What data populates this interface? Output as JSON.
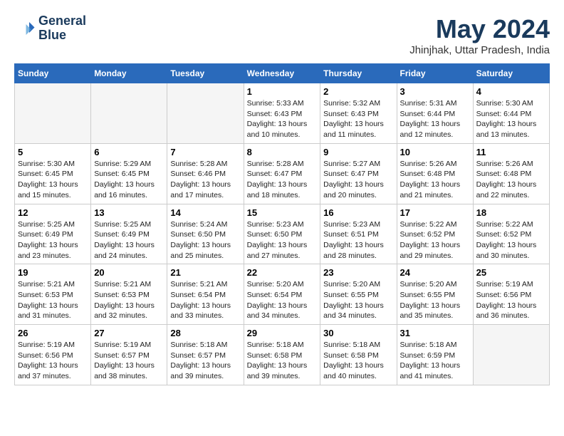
{
  "header": {
    "logo_line1": "General",
    "logo_line2": "Blue",
    "month": "May 2024",
    "location": "Jhinjhak, Uttar Pradesh, India"
  },
  "weekdays": [
    "Sunday",
    "Monday",
    "Tuesday",
    "Wednesday",
    "Thursday",
    "Friday",
    "Saturday"
  ],
  "weeks": [
    [
      {
        "day": "",
        "empty": true
      },
      {
        "day": "",
        "empty": true
      },
      {
        "day": "",
        "empty": true
      },
      {
        "day": "1",
        "sunrise": "5:33 AM",
        "sunset": "6:43 PM",
        "daylight": "13 hours and 10 minutes."
      },
      {
        "day": "2",
        "sunrise": "5:32 AM",
        "sunset": "6:43 PM",
        "daylight": "13 hours and 11 minutes."
      },
      {
        "day": "3",
        "sunrise": "5:31 AM",
        "sunset": "6:44 PM",
        "daylight": "13 hours and 12 minutes."
      },
      {
        "day": "4",
        "sunrise": "5:30 AM",
        "sunset": "6:44 PM",
        "daylight": "13 hours and 13 minutes."
      }
    ],
    [
      {
        "day": "5",
        "sunrise": "5:30 AM",
        "sunset": "6:45 PM",
        "daylight": "13 hours and 15 minutes."
      },
      {
        "day": "6",
        "sunrise": "5:29 AM",
        "sunset": "6:45 PM",
        "daylight": "13 hours and 16 minutes."
      },
      {
        "day": "7",
        "sunrise": "5:28 AM",
        "sunset": "6:46 PM",
        "daylight": "13 hours and 17 minutes."
      },
      {
        "day": "8",
        "sunrise": "5:28 AM",
        "sunset": "6:47 PM",
        "daylight": "13 hours and 18 minutes."
      },
      {
        "day": "9",
        "sunrise": "5:27 AM",
        "sunset": "6:47 PM",
        "daylight": "13 hours and 20 minutes."
      },
      {
        "day": "10",
        "sunrise": "5:26 AM",
        "sunset": "6:48 PM",
        "daylight": "13 hours and 21 minutes."
      },
      {
        "day": "11",
        "sunrise": "5:26 AM",
        "sunset": "6:48 PM",
        "daylight": "13 hours and 22 minutes."
      }
    ],
    [
      {
        "day": "12",
        "sunrise": "5:25 AM",
        "sunset": "6:49 PM",
        "daylight": "13 hours and 23 minutes."
      },
      {
        "day": "13",
        "sunrise": "5:25 AM",
        "sunset": "6:49 PM",
        "daylight": "13 hours and 24 minutes."
      },
      {
        "day": "14",
        "sunrise": "5:24 AM",
        "sunset": "6:50 PM",
        "daylight": "13 hours and 25 minutes."
      },
      {
        "day": "15",
        "sunrise": "5:23 AM",
        "sunset": "6:50 PM",
        "daylight": "13 hours and 27 minutes."
      },
      {
        "day": "16",
        "sunrise": "5:23 AM",
        "sunset": "6:51 PM",
        "daylight": "13 hours and 28 minutes."
      },
      {
        "day": "17",
        "sunrise": "5:22 AM",
        "sunset": "6:52 PM",
        "daylight": "13 hours and 29 minutes."
      },
      {
        "day": "18",
        "sunrise": "5:22 AM",
        "sunset": "6:52 PM",
        "daylight": "13 hours and 30 minutes."
      }
    ],
    [
      {
        "day": "19",
        "sunrise": "5:21 AM",
        "sunset": "6:53 PM",
        "daylight": "13 hours and 31 minutes."
      },
      {
        "day": "20",
        "sunrise": "5:21 AM",
        "sunset": "6:53 PM",
        "daylight": "13 hours and 32 minutes."
      },
      {
        "day": "21",
        "sunrise": "5:21 AM",
        "sunset": "6:54 PM",
        "daylight": "13 hours and 33 minutes."
      },
      {
        "day": "22",
        "sunrise": "5:20 AM",
        "sunset": "6:54 PM",
        "daylight": "13 hours and 34 minutes."
      },
      {
        "day": "23",
        "sunrise": "5:20 AM",
        "sunset": "6:55 PM",
        "daylight": "13 hours and 34 minutes."
      },
      {
        "day": "24",
        "sunrise": "5:20 AM",
        "sunset": "6:55 PM",
        "daylight": "13 hours and 35 minutes."
      },
      {
        "day": "25",
        "sunrise": "5:19 AM",
        "sunset": "6:56 PM",
        "daylight": "13 hours and 36 minutes."
      }
    ],
    [
      {
        "day": "26",
        "sunrise": "5:19 AM",
        "sunset": "6:56 PM",
        "daylight": "13 hours and 37 minutes."
      },
      {
        "day": "27",
        "sunrise": "5:19 AM",
        "sunset": "6:57 PM",
        "daylight": "13 hours and 38 minutes."
      },
      {
        "day": "28",
        "sunrise": "5:18 AM",
        "sunset": "6:57 PM",
        "daylight": "13 hours and 39 minutes."
      },
      {
        "day": "29",
        "sunrise": "5:18 AM",
        "sunset": "6:58 PM",
        "daylight": "13 hours and 39 minutes."
      },
      {
        "day": "30",
        "sunrise": "5:18 AM",
        "sunset": "6:58 PM",
        "daylight": "13 hours and 40 minutes."
      },
      {
        "day": "31",
        "sunrise": "5:18 AM",
        "sunset": "6:59 PM",
        "daylight": "13 hours and 41 minutes."
      },
      {
        "day": "",
        "empty": true
      }
    ]
  ]
}
